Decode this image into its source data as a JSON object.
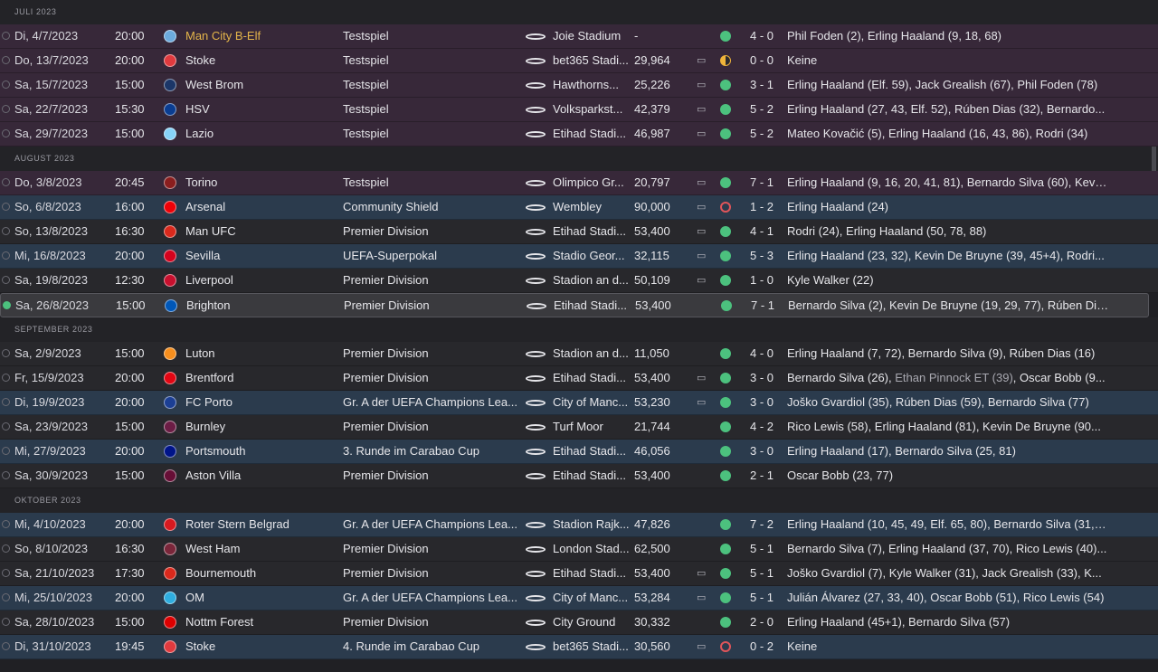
{
  "colors": {
    "win": "#4cc17e",
    "loss": "#e0555a",
    "draw": "#f0b43a",
    "highlight": "#e3b44a",
    "friendly_row": "#372839",
    "cup_row": "#2b3b4d"
  },
  "months": [
    {
      "label": "JULI 2023",
      "matches": [
        {
          "date": "Di, 4/7/2023",
          "time": "20:00",
          "team": "Man City B-Elf",
          "comp": "Testspiel",
          "stadium": "Joie Stadium",
          "att": "-",
          "tv": false,
          "res": "win",
          "score": "4 - 0",
          "scorers": "Phil Foden (2), Erling Haaland (9, 18, 68)",
          "type": "friendly",
          "highlight": true,
          "crest": "#6cabdd",
          "done": false
        },
        {
          "date": "Do, 13/7/2023",
          "time": "20:00",
          "team": "Stoke",
          "comp": "Testspiel",
          "stadium": "bet365 Stadi...",
          "att": "29,964",
          "tv": true,
          "res": "draw",
          "score": "0 - 0",
          "scorers": "Keine",
          "type": "friendly",
          "crest": "#e03a3e",
          "done": false
        },
        {
          "date": "Sa, 15/7/2023",
          "time": "15:00",
          "team": "West Brom",
          "comp": "Testspiel",
          "stadium": "Hawthorns...",
          "att": "25,226",
          "tv": true,
          "res": "win",
          "score": "3 - 1",
          "scorers": "Erling Haaland (Elf. 59), Jack Grealish (67), Phil Foden (78)",
          "type": "friendly",
          "crest": "#1b3668",
          "done": false
        },
        {
          "date": "Sa, 22/7/2023",
          "time": "15:30",
          "team": "HSV",
          "comp": "Testspiel",
          "stadium": "Volksparkst...",
          "att": "42,379",
          "tv": true,
          "res": "win",
          "score": "5 - 2",
          "scorers": "Erling Haaland (27, 43, Elf. 52), Rúben Dias (32), Bernardo...",
          "type": "friendly",
          "crest": "#0a3d91",
          "done": false
        },
        {
          "date": "Sa, 29/7/2023",
          "time": "15:00",
          "team": "Lazio",
          "comp": "Testspiel",
          "stadium": "Etihad Stadi...",
          "att": "46,987",
          "tv": true,
          "res": "win",
          "score": "5 - 2",
          "scorers": "Mateo Kovačić (5), Erling Haaland (16, 43, 86), Rodri (34)",
          "type": "friendly",
          "crest": "#87d3f8",
          "done": false
        }
      ]
    },
    {
      "label": "AUGUST 2023",
      "matches": [
        {
          "date": "Do, 3/8/2023",
          "time": "20:45",
          "team": "Torino",
          "comp": "Testspiel",
          "stadium": "Olimpico Gr...",
          "att": "20,797",
          "tv": true,
          "res": "win",
          "score": "7 - 1",
          "scorers": "Erling Haaland (9, 16, 20, 41, 81), Bernardo Silva (60), Kevin...",
          "type": "friendly",
          "crest": "#8a1e1e",
          "done": false
        },
        {
          "date": "So, 6/8/2023",
          "time": "16:00",
          "team": "Arsenal",
          "comp": "Community Shield",
          "stadium": "Wembley",
          "att": "90,000",
          "tv": true,
          "res": "loss",
          "score": "1 - 2",
          "scorers": "Erling Haaland (24)",
          "type": "cup",
          "crest": "#ef0107",
          "done": false
        },
        {
          "date": "So, 13/8/2023",
          "time": "16:30",
          "team": "Man UFC",
          "comp": "Premier Division",
          "stadium": "Etihad Stadi...",
          "att": "53,400",
          "tv": true,
          "res": "win",
          "score": "4 - 1",
          "scorers": "Rodri (24), Erling Haaland (50, 78, 88)",
          "type": "league",
          "crest": "#da291c",
          "done": false
        },
        {
          "date": "Mi, 16/8/2023",
          "time": "20:00",
          "team": "Sevilla",
          "comp": "UEFA-Superpokal",
          "stadium": "Stadio Geor...",
          "att": "32,115",
          "tv": true,
          "res": "win",
          "score": "5 - 3",
          "scorers": "Erling Haaland (23, 32), Kevin De Bruyne (39, 45+4), Rodri...",
          "type": "cup",
          "crest": "#d4021d",
          "done": false
        },
        {
          "date": "Sa, 19/8/2023",
          "time": "12:30",
          "team": "Liverpool",
          "comp": "Premier Division",
          "stadium": "Stadion an d...",
          "att": "50,109",
          "tv": true,
          "res": "win",
          "score": "1 - 0",
          "scorers": "Kyle Walker (22)",
          "type": "league",
          "crest": "#c8102e",
          "done": false
        },
        {
          "date": "Sa, 26/8/2023",
          "time": "15:00",
          "team": "Brighton",
          "comp": "Premier Division",
          "stadium": "Etihad Stadi...",
          "att": "53,400",
          "tv": false,
          "res": "win",
          "score": "7 - 1",
          "scorers": "Bernardo Silva (2), Kevin De Bruyne (19, 29, 77), Rúben Dia...",
          "type": "selected",
          "crest": "#0057b8",
          "done": true
        }
      ]
    },
    {
      "label": "SEPTEMBER 2023",
      "matches": [
        {
          "date": "Sa, 2/9/2023",
          "time": "15:00",
          "team": "Luton",
          "comp": "Premier Division",
          "stadium": "Stadion an d...",
          "att": "11,050",
          "tv": false,
          "res": "win",
          "score": "4 - 0",
          "scorers": "Erling Haaland (7, 72), Bernardo Silva (9), Rúben Dias (16)",
          "type": "league",
          "crest": "#f78f1e",
          "done": false
        },
        {
          "date": "Fr, 15/9/2023",
          "time": "20:00",
          "team": "Brentford",
          "comp": "Premier Division",
          "stadium": "Etihad Stadi...",
          "att": "53,400",
          "tv": true,
          "res": "win",
          "score": "3 - 0",
          "scorers": "Bernardo Silva (26), ",
          "scorers_opp": "Ethan Pinnock ET (39)",
          "scorers_tail": ", Oscar Bobb (9...",
          "type": "league",
          "crest": "#e30613",
          "done": false
        },
        {
          "date": "Di, 19/9/2023",
          "time": "20:00",
          "team": "FC Porto",
          "comp": "Gr. A der UEFA Champions Lea...",
          "stadium": "City of Manc...",
          "att": "53,230",
          "tv": true,
          "res": "win",
          "score": "3 - 0",
          "scorers": "Joško Gvardiol (35), Rúben Dias (59), Bernardo Silva (77)",
          "type": "cup",
          "crest": "#1c3f94",
          "done": false
        },
        {
          "date": "Sa, 23/9/2023",
          "time": "15:00",
          "team": "Burnley",
          "comp": "Premier Division",
          "stadium": "Turf Moor",
          "att": "21,744",
          "tv": false,
          "res": "win",
          "score": "4 - 2",
          "scorers": "Rico Lewis (58), Erling Haaland (81), Kevin De Bruyne (90...",
          "type": "league",
          "crest": "#6c1d45",
          "done": false
        },
        {
          "date": "Mi, 27/9/2023",
          "time": "20:00",
          "team": "Portsmouth",
          "comp": "3. Runde im Carabao Cup",
          "stadium": "Etihad Stadi...",
          "att": "46,056",
          "tv": false,
          "res": "win",
          "score": "3 - 0",
          "scorers": "Erling Haaland (17), Bernardo Silva (25, 81)",
          "type": "cup",
          "crest": "#001489",
          "done": false
        },
        {
          "date": "Sa, 30/9/2023",
          "time": "15:00",
          "team": "Aston Villa",
          "comp": "Premier Division",
          "stadium": "Etihad Stadi...",
          "att": "53,400",
          "tv": false,
          "res": "win",
          "score": "2 - 1",
          "scorers": "Oscar Bobb (23, 77)",
          "type": "league",
          "crest": "#670e36",
          "done": false
        }
      ]
    },
    {
      "label": "OKTOBER 2023",
      "matches": [
        {
          "date": "Mi, 4/10/2023",
          "time": "20:00",
          "team": "Roter Stern Belgrad",
          "comp": "Gr. A der UEFA Champions Lea...",
          "stadium": "Stadion Rajk...",
          "att": "47,826",
          "tv": false,
          "res": "win",
          "score": "7 - 2",
          "scorers": "Erling Haaland (10, 45, 49, Elf. 65, 80), Bernardo Silva (31, 3...",
          "type": "cup",
          "crest": "#d71920",
          "done": false
        },
        {
          "date": "So, 8/10/2023",
          "time": "16:30",
          "team": "West Ham",
          "comp": "Premier Division",
          "stadium": "London Stad...",
          "att": "62,500",
          "tv": false,
          "res": "win",
          "score": "5 - 1",
          "scorers": "Bernardo Silva (7), Erling Haaland (37, 70), Rico Lewis (40)...",
          "type": "league",
          "crest": "#7a263a",
          "done": false
        },
        {
          "date": "Sa, 21/10/2023",
          "time": "17:30",
          "team": "Bournemouth",
          "comp": "Premier Division",
          "stadium": "Etihad Stadi...",
          "att": "53,400",
          "tv": true,
          "res": "win",
          "score": "5 - 1",
          "scorers": "Joško Gvardiol (7), Kyle Walker (31), Jack Grealish (33), K...",
          "type": "league",
          "crest": "#da291c",
          "done": false
        },
        {
          "date": "Mi, 25/10/2023",
          "time": "20:00",
          "team": "OM",
          "comp": "Gr. A der UEFA Champions Lea...",
          "stadium": "City of Manc...",
          "att": "53,284",
          "tv": true,
          "res": "win",
          "score": "5 - 1",
          "scorers": "Julián Álvarez (27, 33, 40), Oscar Bobb (51), Rico Lewis (54)",
          "type": "cup",
          "crest": "#2faee0",
          "done": false
        },
        {
          "date": "Sa, 28/10/2023",
          "time": "15:00",
          "team": "Nottm Forest",
          "comp": "Premier Division",
          "stadium": "City Ground",
          "att": "30,332",
          "tv": false,
          "res": "win",
          "score": "2 - 0",
          "scorers": "Erling Haaland (45+1), Bernardo Silva (57)",
          "type": "league",
          "crest": "#dd0000",
          "done": false
        },
        {
          "date": "Di, 31/10/2023",
          "time": "19:45",
          "team": "Stoke",
          "comp": "4. Runde im Carabao Cup",
          "stadium": "bet365 Stadi...",
          "att": "30,560",
          "tv": true,
          "res": "loss",
          "score": "0 - 2",
          "scorers": "Keine",
          "type": "cup",
          "crest": "#e03a3e",
          "done": false
        }
      ]
    }
  ]
}
